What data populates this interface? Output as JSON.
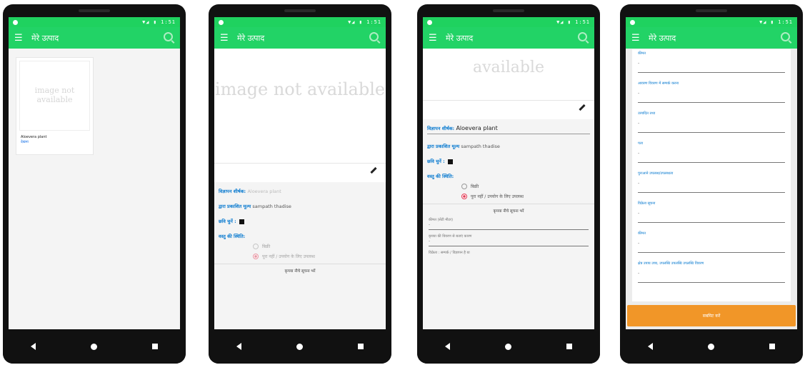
{
  "app": {
    "title": "मेरे उत्पाद",
    "status_time": "▼◢ ▮ 1:51"
  },
  "phone1": {
    "image_placeholder": "image not available",
    "card": {
      "name": "Aloevera plant",
      "subtitle": "देखना"
    }
  },
  "detail": {
    "image_placeholder": "image not available",
    "title_label": "विज्ञापन शीर्षक:",
    "title_value": "Aloevera plant",
    "poster_label": "द्वारा प्रकाशित मूल्य",
    "poster_value": "sampath thadise",
    "image_upload_label": "छवि चुनें :",
    "status_label": "वस्तु की स्थिति:",
    "radio_options": [
      "बिक्री",
      "पूरा नहीं / उपयोग के लिए उपलब्ध"
    ],
    "selected_option": 1,
    "section_title": "कृपया नीचे सूचना भरें",
    "fields": [
      "कीमत (सेंटी मीटर)",
      "कृपया की विवरण से बताएं कारण",
      "विक्रेता : सम्पर्क / विज्ञापन है या"
    ]
  },
  "phone3": {
    "image_placeholder": "available"
  },
  "phone4": {
    "fields": [
      "कीमत",
      "आवरण विवरण में सम्पर्क करना",
      "उत्पादित तथ्य",
      "पता",
      "पुनःआने उपलब्ध/उपलब्धता",
      "विक्रेता सूचना",
      "कीमत",
      "क्षेत्र उपाय उच्च, उपलब्धि उपलब्धि उपलब्धि विवरण"
    ],
    "field_value": "-",
    "submit_label": "सबमिट करें"
  },
  "colors": {
    "statusbar": "#1fd25f",
    "appbar": "#22d366",
    "accent": "#0b7bd0",
    "submit": "#f19628",
    "radio_selected": "#e43b55"
  },
  "icons": [
    "menu-icon",
    "search-icon",
    "pencil-icon",
    "back-icon",
    "home-icon",
    "recent-apps-icon"
  ]
}
